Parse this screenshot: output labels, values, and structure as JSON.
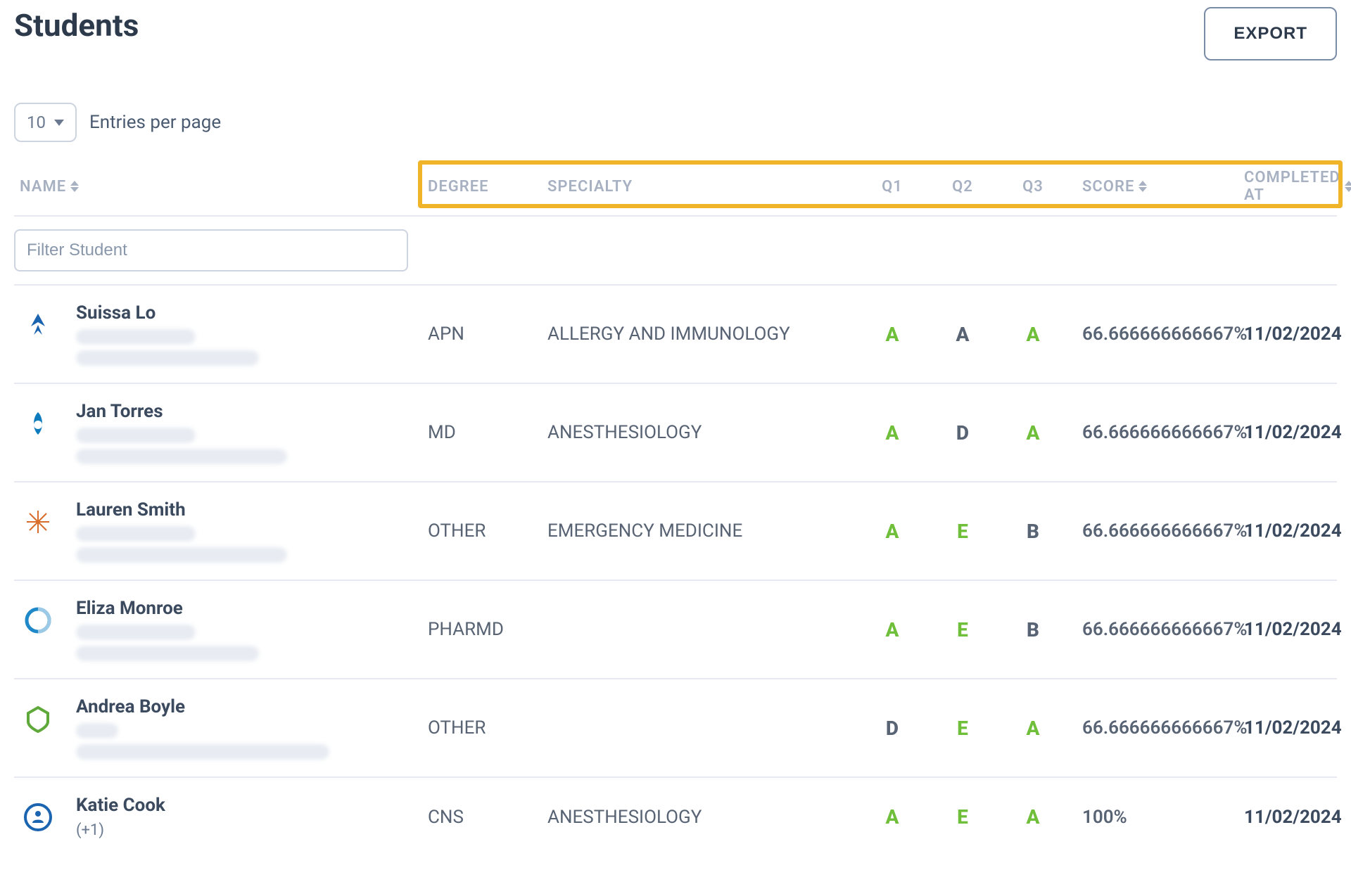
{
  "header": {
    "title": "Students",
    "export_label": "EXPORT"
  },
  "controls": {
    "entries_value": "10",
    "entries_label": "Entries per page"
  },
  "filter": {
    "placeholder": "Filter Student"
  },
  "columns": {
    "name": "NAME",
    "degree": "DEGREE",
    "specialty": "SPECIALTY",
    "q1": "Q1",
    "q2": "Q2",
    "q3": "Q3",
    "score": "SCORE",
    "completed_at": "COMPLETED AT"
  },
  "rows": [
    {
      "name": "Suissa Lo",
      "degree": "APN",
      "specialty": "ALLERGY AND IMMUNOLOGY",
      "q1": "A",
      "q2": "A",
      "q3": "A",
      "score": "66.666666666667%",
      "completed_at": "11/02/2024"
    },
    {
      "name": "Jan Torres",
      "degree": "MD",
      "specialty": "ANESTHESIOLOGY",
      "q1": "A",
      "q2": "D",
      "q3": "A",
      "score": "66.666666666667%",
      "completed_at": "11/02/2024"
    },
    {
      "name": "Lauren Smith",
      "degree": "OTHER",
      "specialty": "EMERGENCY MEDICINE",
      "q1": "A",
      "q2": "E",
      "q3": "B",
      "score": "66.666666666667%",
      "completed_at": "11/02/2024"
    },
    {
      "name": "Eliza Monroe",
      "degree": "PHARMD",
      "specialty": "",
      "q1": "A",
      "q2": "E",
      "q3": "B",
      "score": "66.666666666667%",
      "completed_at": "11/02/2024"
    },
    {
      "name": "Andrea Boyle",
      "degree": "OTHER",
      "specialty": "",
      "q1": "D",
      "q2": "E",
      "q3": "A",
      "score": "66.666666666667%",
      "completed_at": "11/02/2024"
    },
    {
      "name": "Katie Cook",
      "sub": "(+1)",
      "degree": "CNS",
      "specialty": "ANESTHESIOLOGY",
      "q1": "A",
      "q2": "E",
      "q3": "A",
      "score": "100%",
      "completed_at": "11/02/2024"
    }
  ],
  "avatar_colors": [
    "#1b64b0",
    "#0e7bbd",
    "#d96b2b",
    "#1e88c9",
    "#5fa83a",
    "#1b64b0"
  ]
}
